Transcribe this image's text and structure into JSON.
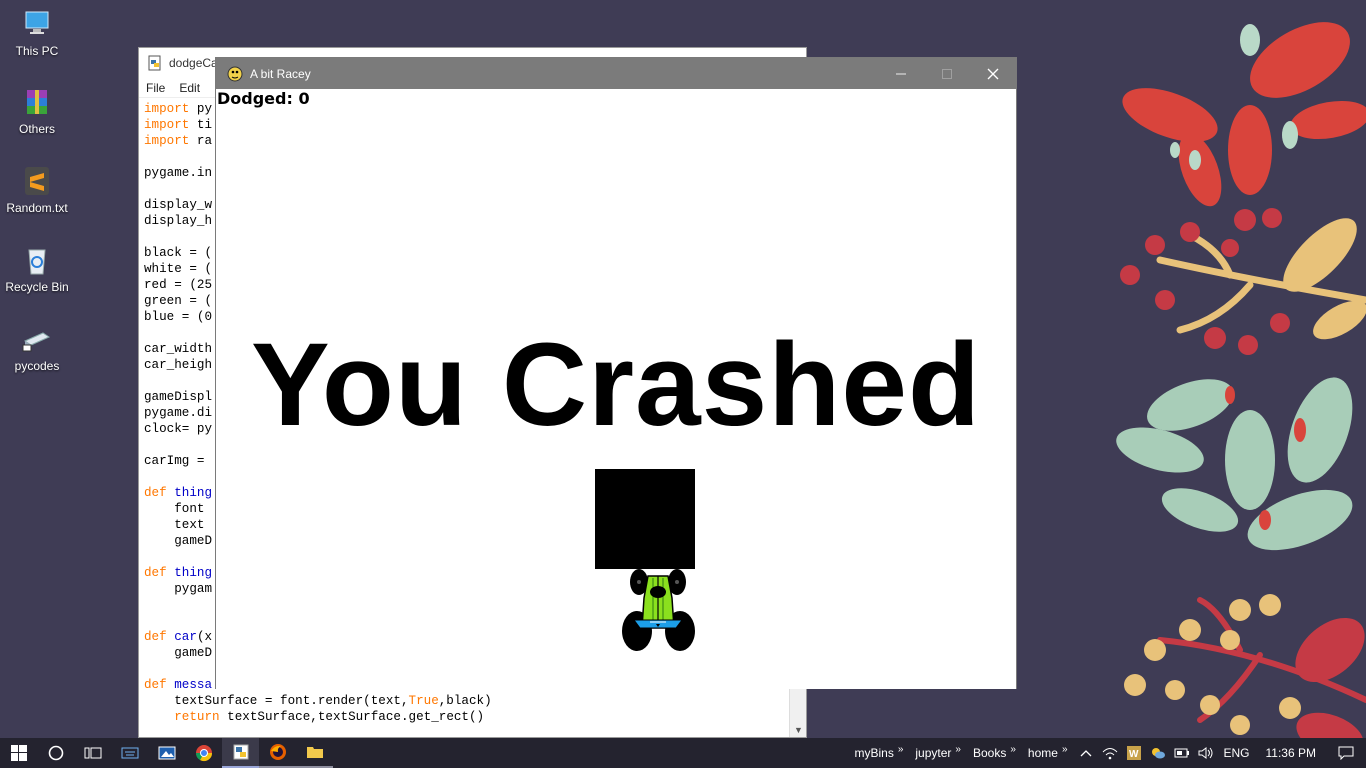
{
  "desktop": {
    "icons": [
      {
        "label": "This PC",
        "icon": "computer-icon"
      },
      {
        "label": "Others",
        "icon": "winrar-archive-icon"
      },
      {
        "label": "Random.txt",
        "icon": "sublime-text-icon"
      },
      {
        "label": "Recycle Bin",
        "icon": "recycle-bin-icon"
      },
      {
        "label": "pycodes",
        "icon": "folder-shortcut-icon"
      }
    ]
  },
  "editor": {
    "title": "dodgeCa",
    "menu": [
      "File",
      "Edit"
    ],
    "code_lines": [
      "import py",
      "import ti",
      "import ra",
      "",
      "pygame.in",
      "",
      "display_w",
      "display_h",
      "",
      "black = (",
      "white = (",
      "red = (25",
      "green = (",
      "blue = (0",
      "",
      "car_width",
      "car_heigh",
      "",
      "gameDispl",
      "pygame.di",
      "clock= py",
      "",
      "carImg = ",
      "",
      "def thing",
      "    font ",
      "    text ",
      "    gameD",
      "",
      "def thing",
      "    pygam",
      "",
      "",
      "def car(x",
      "    gameD",
      "",
      "def messa",
      "    textSurface = font.render(text,True,black)",
      "    return textSurface,textSurface.get_rect()"
    ]
  },
  "game": {
    "title": "A bit Racey",
    "score_label": "Dodged: 0",
    "message": "You Crashed",
    "block_color": "#000000",
    "car_color": "#8be01e"
  },
  "taskbar": {
    "toolbars": [
      "myBins",
      "jupyter",
      "Books",
      "home"
    ],
    "language": "ENG",
    "time": "11:36 PM"
  }
}
